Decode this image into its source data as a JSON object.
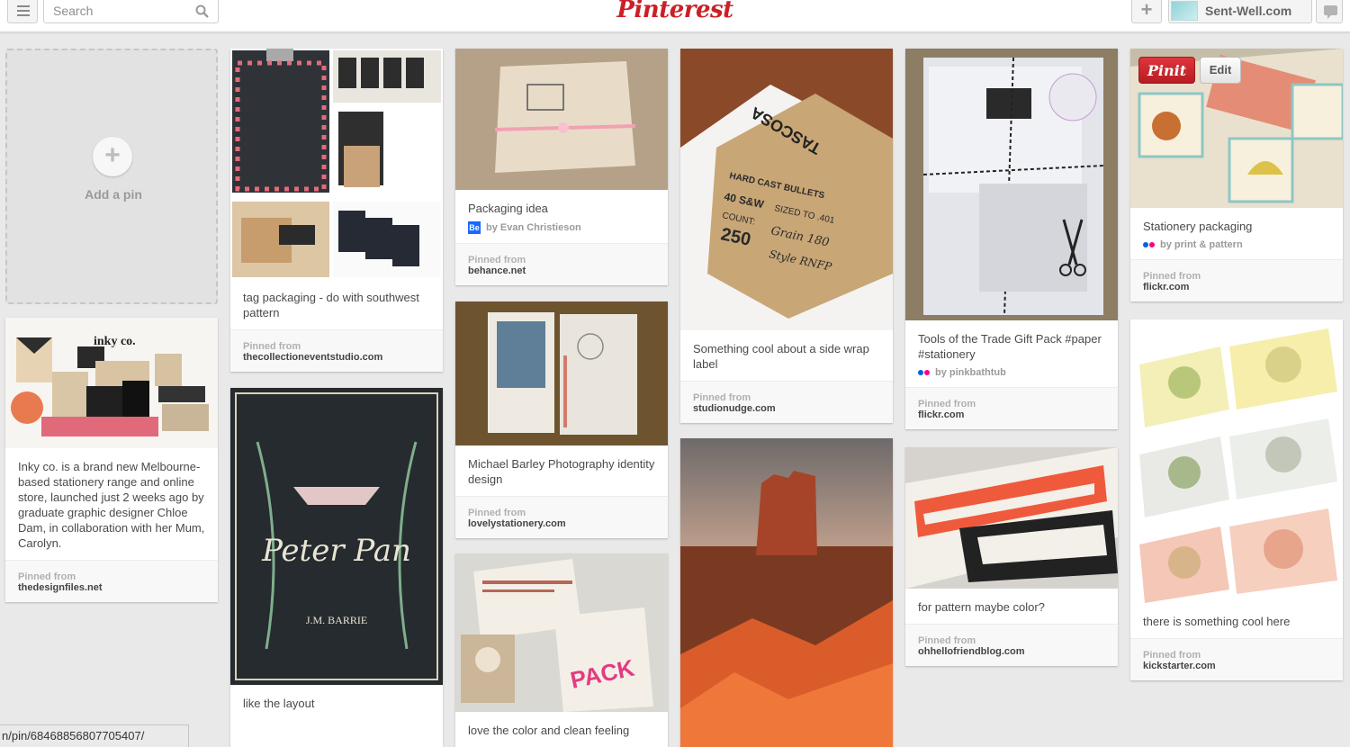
{
  "header": {
    "search_placeholder": "Search",
    "logo": "Pinterest",
    "user_name": "Sent-Well.com",
    "icons": [
      "menu-icon",
      "search-icon",
      "plus-icon",
      "notification-icon"
    ]
  },
  "add_pin": {
    "label": "Add a pin",
    "icon": "plus"
  },
  "pins": {
    "tag_packaging": {
      "description": "tag packaging - do with southwest pattern",
      "source_label": "Pinned from",
      "source": "thecollectioneventstudio.com"
    },
    "inky": {
      "description": "Inky co. is a brand new Melbourne-based stationery range and online store, launched just 2 weeks ago by graduate graphic designer Chloe Dam, in collaboration with her Mum, Carolyn.",
      "source_label": "Pinned from",
      "source": "thedesignfiles.net",
      "image_text": "inky co."
    },
    "peter_pan": {
      "description": "like the layout",
      "image_title": "Peter Pan",
      "image_author": "J.M. BARRIE"
    },
    "packaging_idea": {
      "description": "Packaging idea",
      "attribution": "by Evan Christieson",
      "attribution_badge": "Be",
      "source_label": "Pinned from",
      "source": "behance.net"
    },
    "michael_barley": {
      "description": "Michael Barley Photography identity design",
      "source_label": "Pinned from",
      "source": "lovelystationery.com"
    },
    "love_color": {
      "description": "love the color and clean feeling",
      "image_text": "PACK"
    },
    "side_wrap": {
      "description": "Something cool about a side wrap label",
      "source_label": "Pinned from",
      "source": "studionudge.com",
      "image_lines": [
        "TASCOSA",
        "HARD CAST BULLETS",
        "40 S&W",
        "SIZED TO .401",
        "COUNT:",
        "Grain 180",
        "250",
        "Style RNFP"
      ]
    },
    "tools_trade": {
      "description": "Tools of the Trade Gift Pack #paper #stationery",
      "attribution": "by pinkbathtub",
      "source_label": "Pinned from",
      "source": "flickr.com"
    },
    "pattern_color": {
      "description": "for pattern maybe color?",
      "source_label": "Pinned from",
      "source": "ohhellofriendblog.com"
    },
    "stationery_packaging": {
      "description": "Stationery packaging",
      "attribution": "by print & pattern",
      "source_label": "Pinned from",
      "source": "flickr.com",
      "pinit_label": "Pinit",
      "edit_label": "Edit"
    },
    "cool_here": {
      "description": "there is something cool here",
      "source_label": "Pinned from",
      "source": "kickstarter.com"
    }
  },
  "status_bar": {
    "url": "n/pin/68468856807705407/"
  },
  "colors": {
    "accent": "#cb2027",
    "background": "#e9e9e9",
    "behance": "#1769ff"
  }
}
